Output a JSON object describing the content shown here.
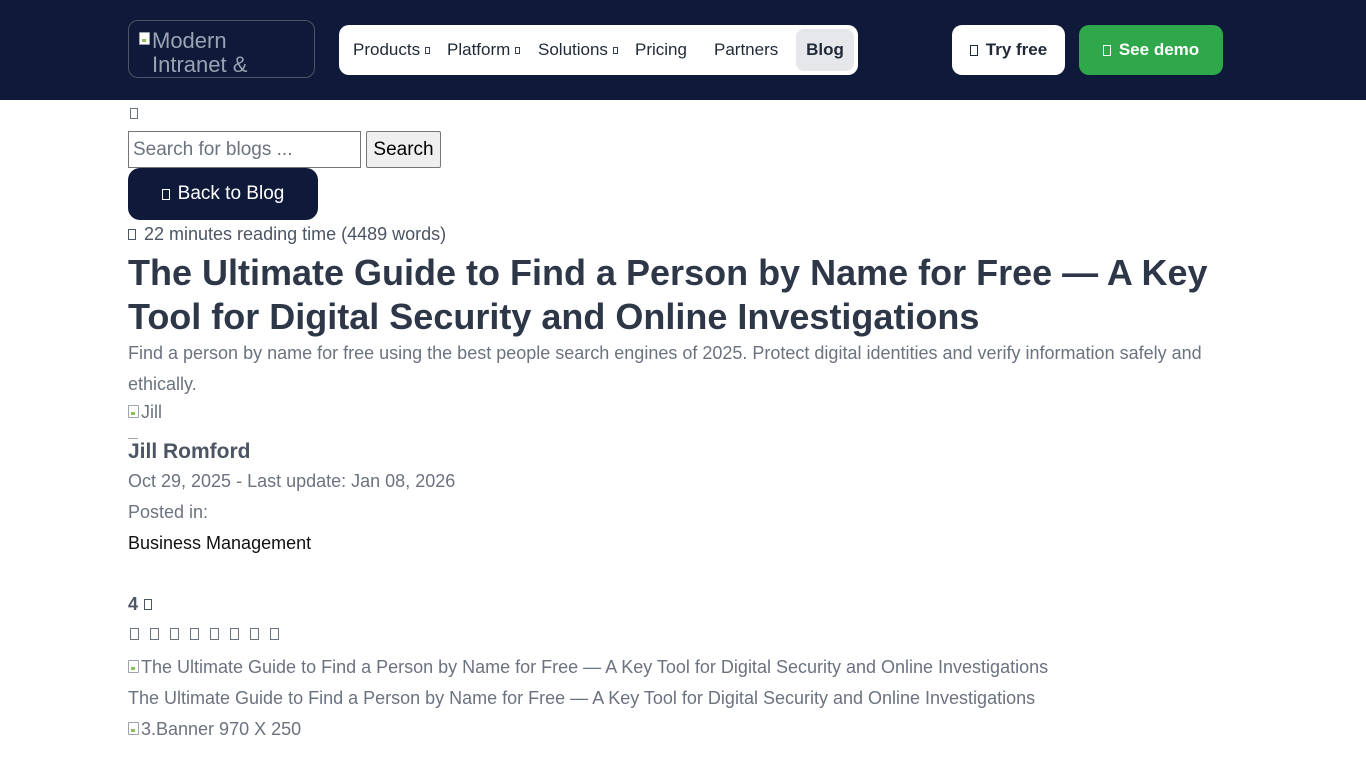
{
  "header": {
    "logo_alt": "Modern Intranet &",
    "nav": [
      {
        "label": "Products"
      },
      {
        "label": "Platform"
      },
      {
        "label": "Solutions"
      },
      {
        "label": "Pricing"
      },
      {
        "label": "Partners"
      },
      {
        "label": "Blog"
      }
    ],
    "try_label": "Try free",
    "demo_label": "See demo"
  },
  "search": {
    "placeholder": "Search for blogs ...",
    "button_label": "Search"
  },
  "back_label": "Back to Blog",
  "reading_time": "22 minutes reading time (4489 words)",
  "article": {
    "title": "The Ultimate Guide to Find a Person by Name for Free — A Key Tool for Digital Security and Online Investigations",
    "subtitle": "Find a person by name for free using the best people search engines of 2025. Protect digital identities and verify information safely and ethically.",
    "author_img_alt": "Jill",
    "author_name": "Jill Romford",
    "dates": "Oct 29, 2025 - Last update: Jan 08, 2026",
    "posted_in_label": "Posted in:",
    "category": "Business Management",
    "rating": "4",
    "hero_alt": "The Ultimate Guide to Find a Person by Name for Free — A Key Tool for Digital Security and Online Investigations",
    "caption": "The Ultimate Guide to Find a Person by Name for Free — A Key Tool for Digital Security and Online Investigations",
    "banner_alt": "3.Banner 970 X 250"
  },
  "colors": {
    "header_bg": "#0f1a3a",
    "demo_green": "#2ea84a",
    "title": "#2d3748"
  }
}
